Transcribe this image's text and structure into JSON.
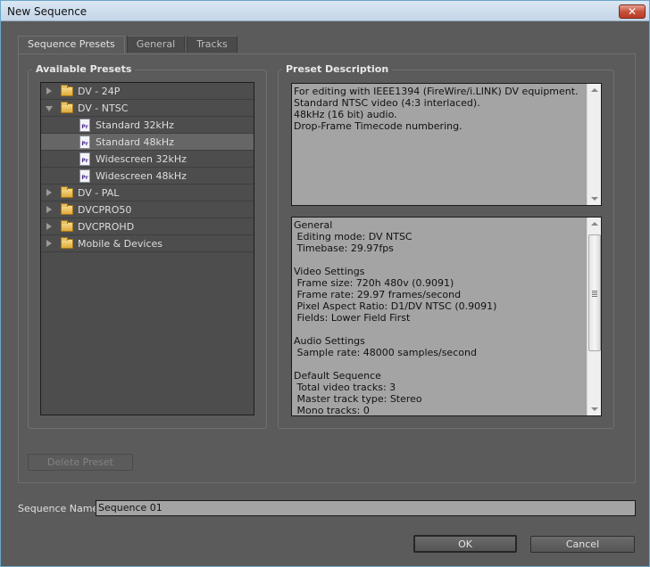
{
  "window": {
    "title": "New Sequence",
    "close_label": "✕"
  },
  "tabs": [
    {
      "label": "Sequence Presets",
      "active": true
    },
    {
      "label": "General",
      "active": false
    },
    {
      "label": "Tracks",
      "active": false
    }
  ],
  "presets": {
    "title": "Available Presets",
    "items": [
      {
        "type": "folder",
        "label": "DV - 24P",
        "expanded": false
      },
      {
        "type": "folder",
        "label": "DV - NTSC",
        "expanded": true
      },
      {
        "type": "file",
        "label": "Standard 32kHz",
        "icon_text": "Pr"
      },
      {
        "type": "file",
        "label": "Standard 48kHz",
        "icon_text": "Pr",
        "selected": true
      },
      {
        "type": "file",
        "label": "Widescreen 32kHz",
        "icon_text": "Pr"
      },
      {
        "type": "file",
        "label": "Widescreen 48kHz",
        "icon_text": "Pr"
      },
      {
        "type": "folder",
        "label": "DV - PAL",
        "expanded": false
      },
      {
        "type": "folder",
        "label": "DVCPRO50",
        "expanded": false
      },
      {
        "type": "folder",
        "label": "DVCPROHD",
        "expanded": false
      },
      {
        "type": "folder",
        "label": "Mobile & Devices",
        "expanded": false
      }
    ]
  },
  "description": {
    "title": "Preset Description",
    "summary": "For editing with IEEE1394 (FireWire/i.LINK) DV equipment.\nStandard NTSC video (4:3 interlaced).\n48kHz (16 bit) audio.\nDrop-Frame Timecode numbering.",
    "details": "General\n Editing mode: DV NTSC\n Timebase: 29.97fps\n\nVideo Settings\n Frame size: 720h 480v (0.9091)\n Frame rate: 29.97 frames/second\n Pixel Aspect Ratio: D1/DV NTSC (0.9091)\n Fields: Lower Field First\n\nAudio Settings\n Sample rate: 48000 samples/second\n\nDefault Sequence\n Total video tracks: 3\n Master track type: Stereo\n Mono tracks: 0"
  },
  "buttons": {
    "delete_preset": "Delete Preset",
    "ok": "OK",
    "cancel": "Cancel"
  },
  "sequence_name": {
    "label": "Sequence Name:",
    "value": "Sequence 01"
  }
}
